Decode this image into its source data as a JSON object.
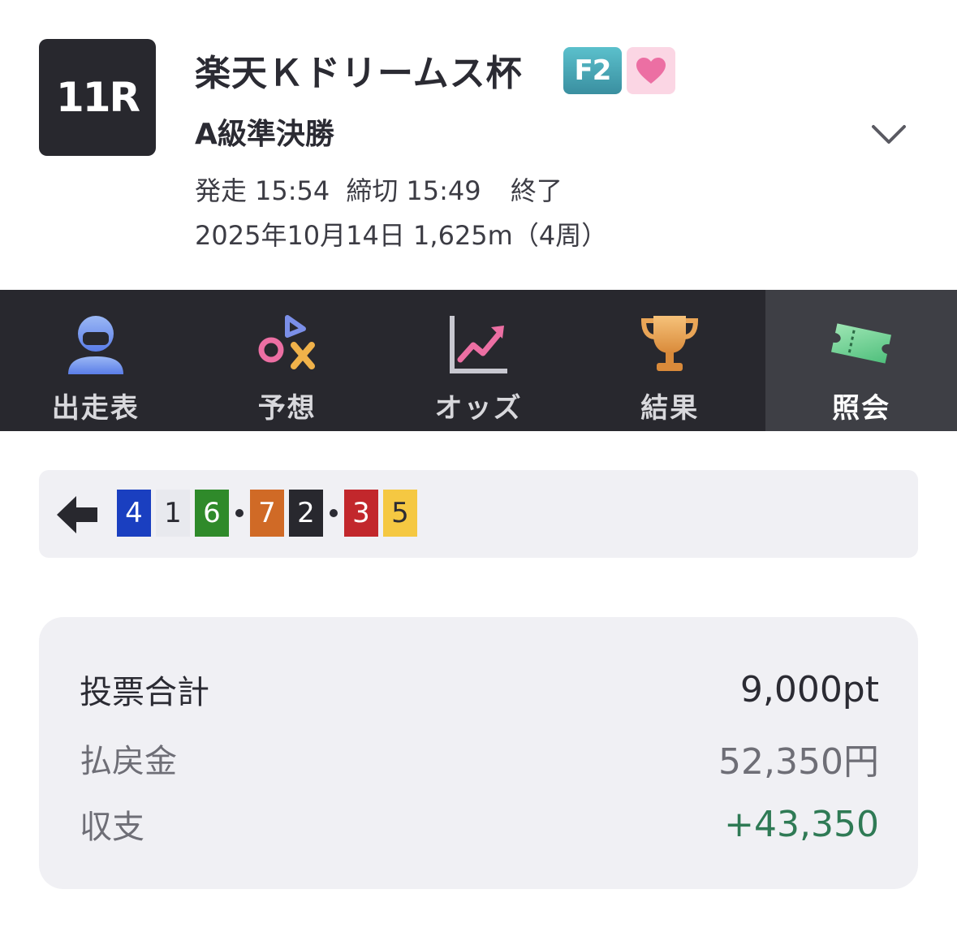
{
  "race": {
    "number": "11R",
    "title": "楽天Ｋドリームス杯",
    "grade": "F2",
    "subtitle": "A級準決勝",
    "start_label": "発走",
    "start_time": "15:54",
    "close_label": "締切",
    "close_time": "15:49",
    "status": "終了",
    "date_distance": "2025年10月14日 1,625m（4周）"
  },
  "tabs": [
    {
      "label": "出走表",
      "icon": "rider-icon"
    },
    {
      "label": "予想",
      "icon": "prediction-symbols-icon"
    },
    {
      "label": "オッズ",
      "icon": "odds-chart-icon"
    },
    {
      "label": "結果",
      "icon": "trophy-icon"
    },
    {
      "label": "照会",
      "icon": "ticket-icon",
      "active": true
    }
  ],
  "combination": {
    "numbers": [
      {
        "n": "4",
        "bg": "#1a3fc0",
        "fg": "#ffffff"
      },
      {
        "n": "1",
        "bg": "#e8e9ee",
        "fg": "#2b2b33"
      },
      {
        "n": "6",
        "bg": "#2f8a2a",
        "fg": "#ffffff"
      },
      {
        "n": "7",
        "bg": "#d06a26",
        "fg": "#ffffff"
      },
      {
        "n": "2",
        "bg": "#28282e",
        "fg": "#ffffff"
      },
      {
        "n": "3",
        "bg": "#c2272c",
        "fg": "#ffffff"
      },
      {
        "n": "5",
        "bg": "#f5c842",
        "fg": "#2b2b33"
      }
    ]
  },
  "summary": {
    "total_label": "投票合計",
    "total_value": "9,000pt",
    "payout_label": "払戻金",
    "payout_value": "52,350円",
    "balance_label": "収支",
    "balance_value": "+43,350"
  },
  "colors": {
    "dark": "#28282e",
    "active_tab": "#3e3f45",
    "panel": "#f0f0f4",
    "profit": "#2f7a55"
  }
}
